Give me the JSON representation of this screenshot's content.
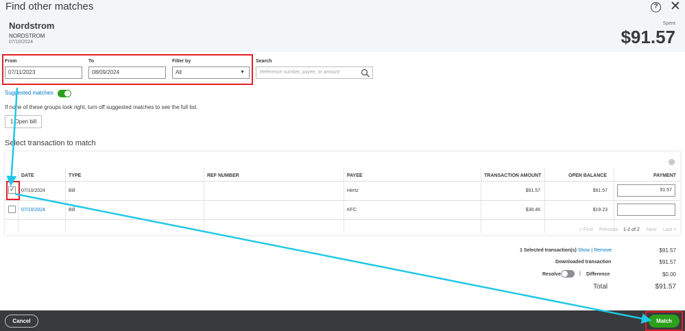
{
  "dialog": {
    "title": "Find other matches"
  },
  "transaction": {
    "payee": "Nordstrom",
    "payee_sub": "NORDSTROM",
    "date": "07/10/2024",
    "spent_label": "Spent",
    "amount": "$91.57"
  },
  "filters": {
    "from_label": "From",
    "from_value": "07/11/2023",
    "to_label": "To",
    "to_value": "08/09/2024",
    "filter_by_label": "Filter by",
    "filter_by_value": "All",
    "search_label": "Search",
    "search_placeholder": "Reference number, payee, or amount"
  },
  "suggested": {
    "label": "Suggested matches",
    "enabled": true,
    "hint": "If none of these groups look right, turn off suggested matches to see the full list.",
    "group_button": "1 Open bill"
  },
  "table": {
    "section_title": "Select transaction to match",
    "columns": [
      "DATE",
      "TYPE",
      "REF NUMBER",
      "PAYEE",
      "TRANSACTION AMOUNT",
      "OPEN BALANCE",
      "PAYMENT"
    ],
    "rows": [
      {
        "checked": true,
        "date": "07/10/2024",
        "type": "Bill",
        "ref": "",
        "payee": "Hertz",
        "amount": "$91.57",
        "open_balance": "$91.57",
        "payment": "91.57"
      },
      {
        "checked": false,
        "date": "07/10/2024",
        "type": "Bill",
        "ref": "",
        "payee": "KFC",
        "amount": "$38.46",
        "open_balance": "$19.23",
        "payment": ""
      }
    ],
    "pager": {
      "first": "< First",
      "previous": "Previous",
      "range": "1-2 of 2",
      "next": "Next",
      "last": "Last >"
    }
  },
  "summary": {
    "selected_label": "1 Selected transaction(s)",
    "show": "Show",
    "separator": "|",
    "remove": "Remove",
    "selected_value": "$91.57",
    "downloaded_label": "Downloaded transaction",
    "downloaded_value": "$91.57",
    "resolve_label": "Resolve",
    "difference_label": "Difference",
    "difference_value": "$0.00",
    "total_label": "Total",
    "total_value": "$91.57"
  },
  "footer": {
    "cancel": "Cancel",
    "match": "Match"
  },
  "colors": {
    "accent_green": "#2ca01c",
    "link_blue": "#0077c5",
    "annotation_red": "#e21f26",
    "annotation_cyan": "#1ec8e6"
  }
}
